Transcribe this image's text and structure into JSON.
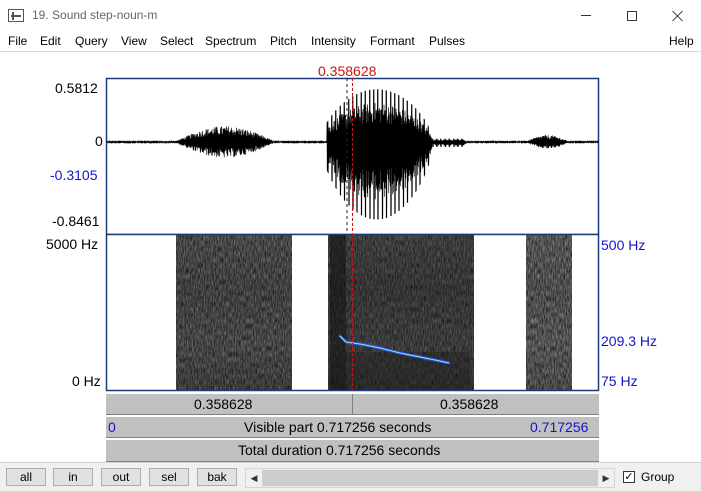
{
  "window": {
    "title": "19. Sound step-noun-m"
  },
  "menu": [
    "File",
    "Edit",
    "Query",
    "View",
    "Select",
    "Spectrum",
    "Pitch",
    "Intensity",
    "Formant",
    "Pulses",
    "Help"
  ],
  "cursor": {
    "time_label": "0.358628",
    "time": 0.358628
  },
  "waveform": {
    "max_label": "0.5812",
    "zero_label": "0",
    "cursor_value_label": "-0.3105",
    "min_label": "-0.8461"
  },
  "spectrogram": {
    "max_freq_label": "5000 Hz",
    "min_freq_label": "0 Hz",
    "pitch_max_label": "500 Hz",
    "pitch_value_label": "209.3 Hz",
    "pitch_min_label": "75 Hz"
  },
  "time_bars": {
    "left_segment": "0.358628",
    "right_segment": "0.358628",
    "visible_start": "0",
    "visible_part": "Visible part 0.717256 seconds",
    "visible_end": "0.717256",
    "total_duration": "Total duration 0.717256 seconds"
  },
  "controls": {
    "buttons": [
      "all",
      "in",
      "out",
      "sel",
      "bak"
    ],
    "group_label": "Group",
    "group_checked": true,
    "check_mark": "✓",
    "scroll_left": "◀",
    "scroll_right": "▶"
  },
  "colors": {
    "cursor": "#d01010",
    "axis_blue": "#1414c8",
    "pitch_line": "#1e5bd6",
    "frame": "#1a3a78"
  }
}
